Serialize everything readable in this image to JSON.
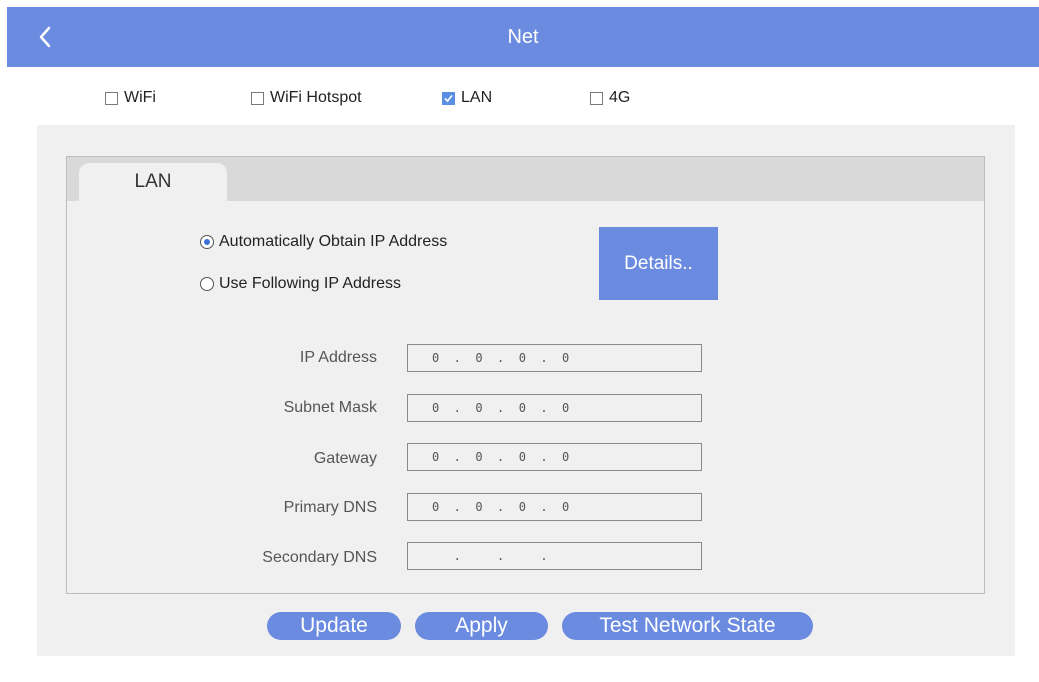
{
  "header": {
    "title": "Net",
    "back_icon": "chevron-left-icon",
    "color": "#6a8bdf"
  },
  "net_options": [
    {
      "label": "WiFi",
      "checked": false
    },
    {
      "label": "WiFi Hotspot",
      "checked": false
    },
    {
      "label": "LAN",
      "checked": true
    },
    {
      "label": "4G",
      "checked": false
    }
  ],
  "tabs": [
    {
      "label": "LAN",
      "active": true
    }
  ],
  "ip_mode": {
    "auto_label": "Automatically Obtain IP Address",
    "manual_label": "Use Following IP Address",
    "selected": "auto"
  },
  "details_button": "Details..",
  "fields": [
    {
      "label": "IP Address",
      "value": "0  .  0  .  0  .  0"
    },
    {
      "label": "Subnet Mask",
      "value": "0  .  0  .  0  .  0"
    },
    {
      "label": "Gateway",
      "value": "0  .  0  .  0  .  0"
    },
    {
      "label": "Primary DNS",
      "value": "0  .  0  .  0  .  0"
    },
    {
      "label": "Secondary DNS",
      "value": "   .     .     ."
    }
  ],
  "buttons": {
    "update": "Update",
    "apply": "Apply",
    "test": "Test Network State"
  }
}
